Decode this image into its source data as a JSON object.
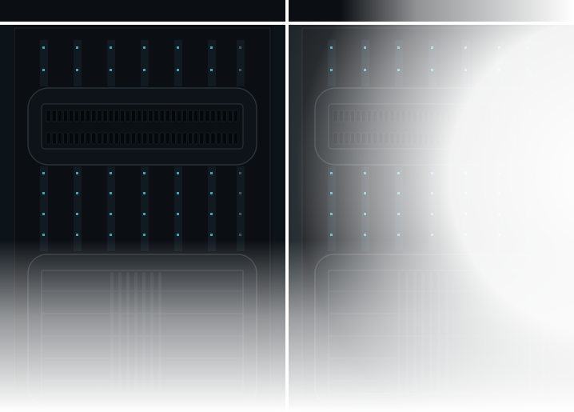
{
  "scene": {
    "background": "#ffffff",
    "rack_color": "#0b0f13",
    "rack_panel": "#111820",
    "frame_line": "#20262c",
    "divider_line": "#ffffff",
    "led_color": "#3fb6c9",
    "port_color": "#05080b",
    "fade_color": "#ffffff"
  },
  "racks": [
    {
      "name": "left-server-rack"
    },
    {
      "name": "right-server-rack"
    }
  ],
  "icons": {
    "rack_icon": "server-rack-icon",
    "led_icon": "status-led-icon",
    "port_icon": "network-port-icon"
  }
}
